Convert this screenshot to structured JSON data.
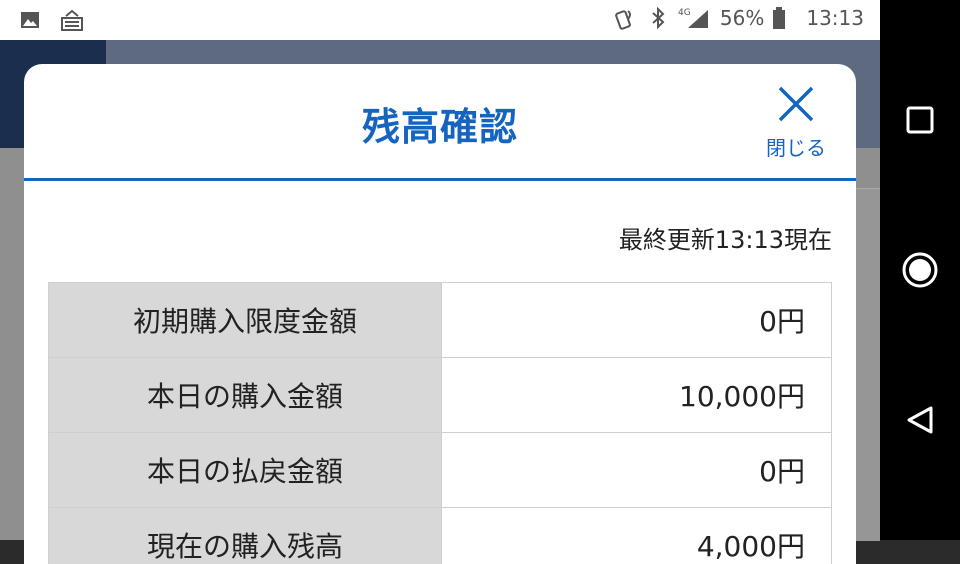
{
  "status_bar": {
    "battery_percent": "56%",
    "network": "4G",
    "time": "13:13",
    "icons": [
      "image-icon",
      "keyboard-icon",
      "nfc-icon",
      "bluetooth-icon",
      "signal-icon",
      "battery-icon"
    ]
  },
  "modal": {
    "title": "残高確認",
    "close_label": "閉じる",
    "updated": "最終更新13:13現在",
    "rows": [
      {
        "label": "初期購入限度金額",
        "value": "0円"
      },
      {
        "label": "本日の購入金額",
        "value": "10,000円"
      },
      {
        "label": "本日の払戻金額",
        "value": "0円"
      },
      {
        "label": "現在の購入残高",
        "value": "4,000円"
      }
    ]
  },
  "colors": {
    "accent": "#1565c0",
    "label_bg": "#d8d8d8",
    "navbar": "#000000"
  },
  "navigation": {
    "buttons": [
      "recents-button",
      "home-button",
      "back-button"
    ]
  }
}
